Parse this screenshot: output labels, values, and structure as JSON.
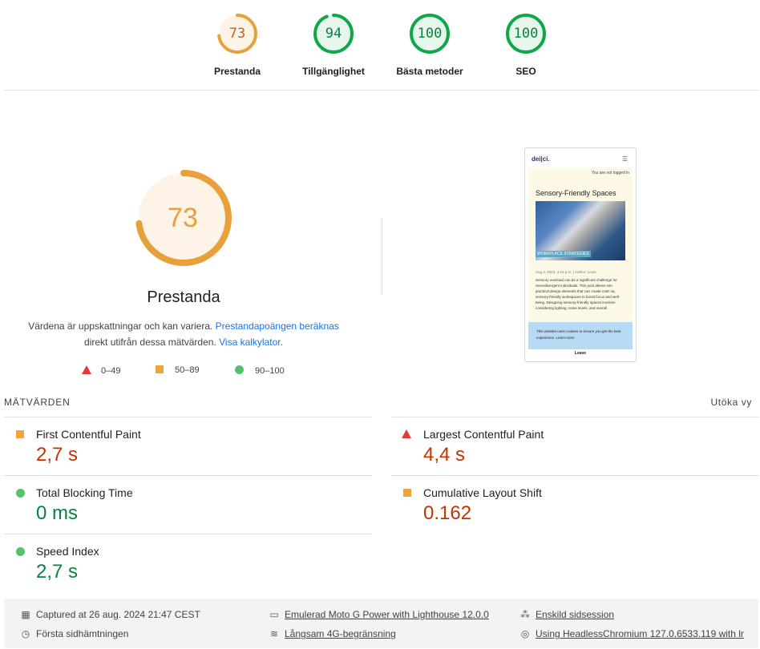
{
  "top_gauges": [
    {
      "score": "73",
      "label": "Prestanda",
      "fraction": 0.73,
      "color": "#e8a13a",
      "bg": "#fdf3e7"
    },
    {
      "score": "94",
      "label": "Tillgänglighet",
      "fraction": 0.94,
      "color": "#0ea74a",
      "bg": "#e6f6ec"
    },
    {
      "score": "100",
      "label": "Bästa metoder",
      "fraction": 1.0,
      "color": "#0ea74a",
      "bg": "#e6f6ec"
    },
    {
      "score": "100",
      "label": "SEO",
      "fraction": 1.0,
      "color": "#0ea74a",
      "bg": "#e6f6ec"
    }
  ],
  "main": {
    "score": "73",
    "fraction": 0.73,
    "title": "Prestanda",
    "desc_text1": "Värdena är uppskattningar och kan variera. ",
    "desc_link1": "Prestandapoängen beräknas",
    "desc_text2": "direkt utifrån dessa mätvärden. ",
    "desc_link2": "Visa kalkylator",
    "desc_end": ".",
    "legend": [
      {
        "shape": "triangle",
        "label": "0–49"
      },
      {
        "shape": "square",
        "label": "50–89"
      },
      {
        "shape": "circle",
        "label": "90–100"
      }
    ]
  },
  "preview": {
    "logo": "dei|ci.",
    "menu_icon": "hamburger-icon",
    "not_logged": "You are not logged in",
    "post_title": "Sensory-Friendly Spaces",
    "image_tag": "WORKPLACE STRATEGIES",
    "meta": "Aug 3, 2024, 3:10 p.m. | Author: Louis",
    "text": "Sensory overload can be a significant challenge for neurodivergent individuals. This post delves into practical design elements that can create calm sq. sensory-friendly workspaces to boost focus and well-being. Designing sensory-friendly spaces involves considering lighting, noise levels, and overall",
    "cookie": "This website uses cookies to ensure you get the best experience. Learn more",
    "leave": "Leave"
  },
  "metrics": {
    "title": "MÄTVÄRDEN",
    "expand": "Utöka vy",
    "items": [
      {
        "name": "First Contentful Paint",
        "value": "2,7 s",
        "rating": "square"
      },
      {
        "name": "Largest Contentful Paint",
        "value": "4,4 s",
        "rating": "triangle"
      },
      {
        "name": "Total Blocking Time",
        "value": "0 ms",
        "rating": "circle"
      },
      {
        "name": "Cumulative Layout Shift",
        "value": "0.162",
        "rating": "square"
      },
      {
        "name": "Speed Index",
        "value": "2,7 s",
        "rating": "circle"
      }
    ]
  },
  "footer": {
    "captured": "Captured at 26 aug. 2024 21:47 CEST",
    "first_load": "Första sidhämtningen",
    "device": "Emulerad Moto G Power with Lighthouse 12.0.0",
    "throttle": "Långsam 4G-begränsning",
    "session": "Enskild sidsession",
    "browser": "Using HeadlessChromium 127.0.6533.119 with lr"
  },
  "colors": {
    "orange": "#e8a13a",
    "green": "#0ea74a",
    "red": "#c33300",
    "link": "#1a73e8"
  }
}
